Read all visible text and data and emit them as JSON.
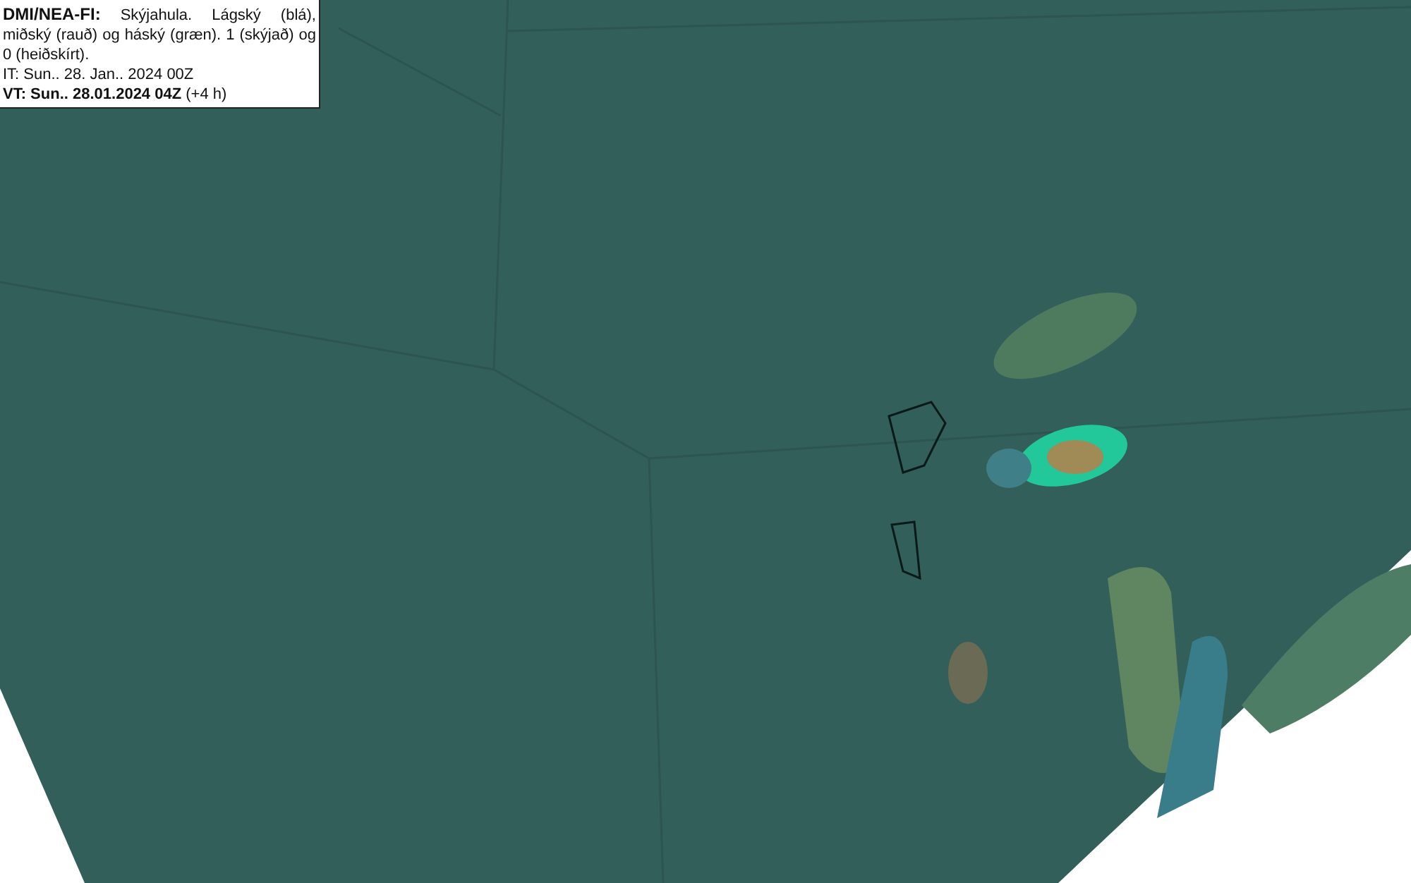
{
  "legend": {
    "description": "**DMI/NEA-FI:** Skýjahula. Lágský (blá), miðský (rauð) og háský (græn). 1 (skýjað) og 0 (heiðskírt).",
    "issue_time": "IT: Sun.. 28. Jan.. 2024 00Z",
    "valid_time": "**VT: Sun.. 28.01.2024 04Z** (+4 h)"
  }
}
